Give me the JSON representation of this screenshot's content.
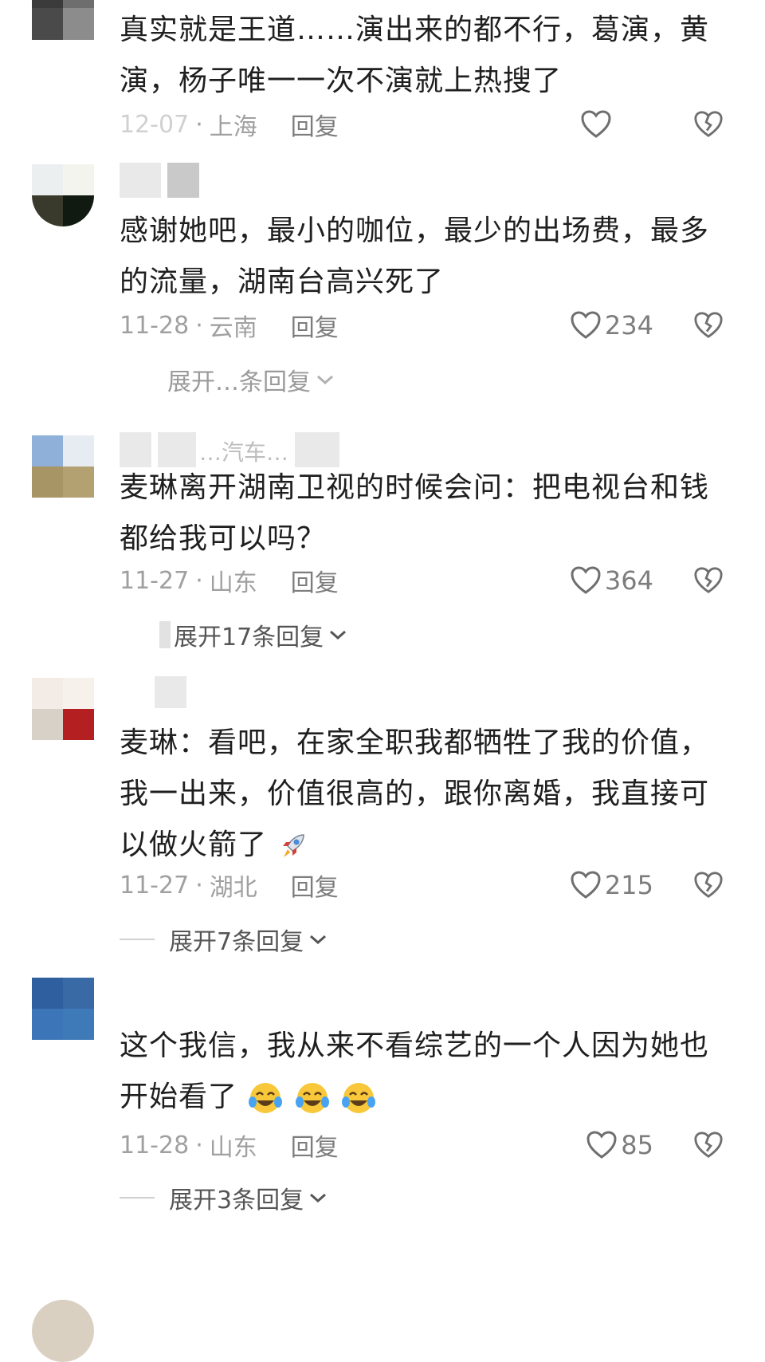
{
  "comments": [
    {
      "name": "",
      "lines": [
        "真实就是王道……演出来的都不行，葛演，黄",
        "演，杨子唯一一次不演就上热搜了"
      ],
      "date": "12-07",
      "location": "上海",
      "reply_label": "回复",
      "likes": "",
      "expand_label": ""
    },
    {
      "name": "",
      "lines": [
        "感谢她吧，最小的咖位，最少的出场费，最多",
        "的流量，湖南台高兴死了"
      ],
      "date": "11-28",
      "location": "云南",
      "reply_label": "回复",
      "likes": "234",
      "expand_label": "展开…条回复"
    },
    {
      "name": "…汽车…",
      "lines": [
        "麦琳离开湖南卫视的时候会问：把电视台和钱",
        "都给我可以吗？"
      ],
      "date": "11-27",
      "location": "山东",
      "reply_label": "回复",
      "likes": "364",
      "expand_label": "展开17条回复"
    },
    {
      "name": "",
      "lines": [
        "麦琳：看吧，在家全职我都牺牲了我的价值，",
        "我一出来，价值很高的，跟你离婚，我直接可",
        "以做火箭了"
      ],
      "date": "11-27",
      "location": "湖北",
      "reply_label": "回复",
      "likes": "215",
      "expand_label": "展开7条回复"
    },
    {
      "name": "",
      "lines": [
        "这个我信，我从来不看综艺的一个人因为她也",
        "开始看了"
      ],
      "date": "11-28",
      "location": "山东",
      "reply_label": "回复",
      "likes": "85",
      "expand_label": "展开3条回复"
    }
  ],
  "icons": {
    "like": "heart-outline-icon",
    "dislike": "broken-heart-icon",
    "expand": "chevron-down-icon",
    "rocket": "rocket-emoji",
    "laugh": "tears-of-joy-emoji"
  },
  "colors": {
    "text": "#1f1f1f",
    "meta": "#a0a0a0",
    "icon": "#6f6f6f"
  }
}
